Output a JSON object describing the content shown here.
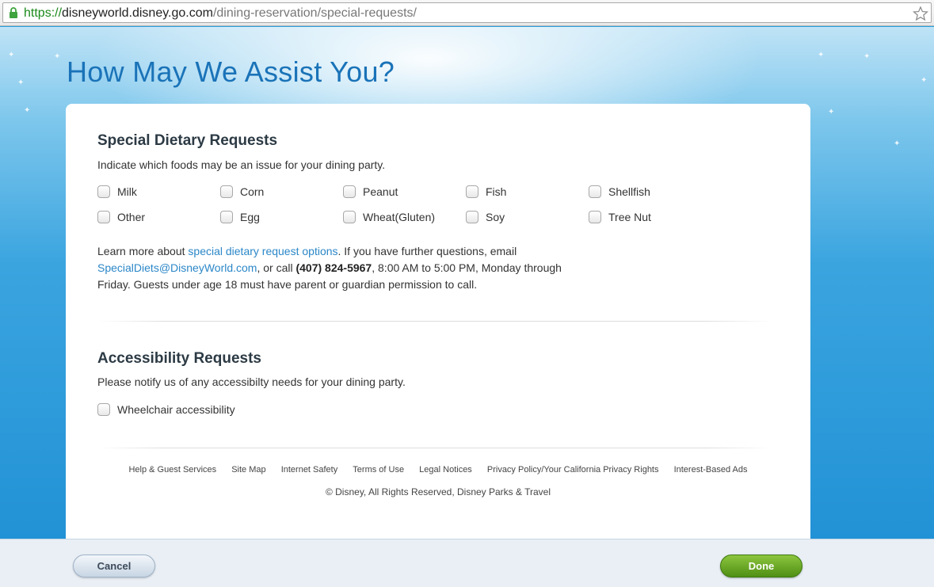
{
  "browser": {
    "url_scheme": "https://",
    "url_host": "disneyworld.disney.go.com",
    "url_path": "/dining-reservation/special-requests/"
  },
  "page": {
    "title": "How May We Assist You?"
  },
  "dietary": {
    "title": "Special Dietary Requests",
    "description": "Indicate which foods may be an issue for your dining party.",
    "options": [
      "Milk",
      "Corn",
      "Peanut",
      "Fish",
      "Shellfish",
      "Other",
      "Egg",
      "Wheat(Gluten)",
      "Soy",
      "Tree Nut"
    ],
    "info": {
      "text1": "Learn more about ",
      "link1": "special dietary request options",
      "text2": ". If you have further questions, email ",
      "email": "SpecialDiets@DisneyWorld.com",
      "text3": ", or call ",
      "phone": "(407) 824-5967",
      "text4": ", 8:00 AM to 5:00 PM, Monday through Friday. Guests under age 18 must have parent or guardian permission to call."
    }
  },
  "accessibility": {
    "title": "Accessibility Requests",
    "description": "Please notify us of any accessibilty needs for your dining party.",
    "options": [
      "Wheelchair accessibility"
    ]
  },
  "footer": {
    "links": [
      "Help & Guest Services",
      "Site Map",
      "Internet Safety",
      "Terms of Use",
      "Legal Notices",
      "Privacy Policy/Your California Privacy Rights",
      "Interest-Based Ads"
    ],
    "copyright": "© Disney, All Rights Reserved, Disney Parks & Travel"
  },
  "actions": {
    "cancel_label": "Cancel",
    "done_label": "Done"
  },
  "icons": {
    "lock": "lock-icon",
    "star": "bookmark-star-icon"
  },
  "colors": {
    "title_blue": "#1a73b8",
    "link_blue": "#2b87c8",
    "done_green": "#6aaa2a"
  }
}
